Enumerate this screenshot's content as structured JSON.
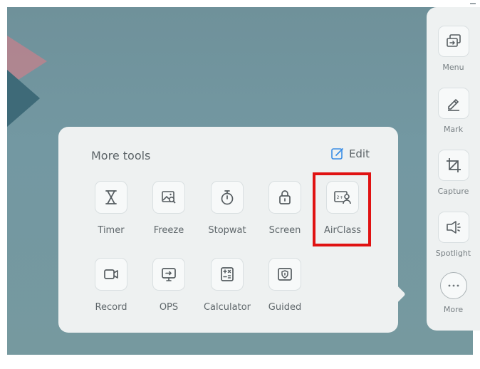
{
  "panel": {
    "title": "More tools",
    "edit_label": "Edit",
    "tools": [
      {
        "label": "Timer",
        "icon": "hourglass-icon"
      },
      {
        "label": "Freeze",
        "icon": "freeze-image-icon"
      },
      {
        "label": "Stopwat",
        "icon": "stopwatch-icon"
      },
      {
        "label": "Screen",
        "icon": "lock-icon"
      },
      {
        "label": "AirClass",
        "icon": "airclass-icon"
      },
      {
        "label": "Record",
        "icon": "video-camera-icon"
      },
      {
        "label": "OPS",
        "icon": "monitor-icon"
      },
      {
        "label": "Calculator",
        "icon": "calculator-icon"
      },
      {
        "label": "Guided",
        "icon": "shield-icon"
      }
    ]
  },
  "sidebar": {
    "items": [
      {
        "label": "Menu",
        "icon": "windows-icon"
      },
      {
        "label": "Mark",
        "icon": "pen-icon"
      },
      {
        "label": "Capture",
        "icon": "crop-icon"
      },
      {
        "label": "Spotlight",
        "icon": "spotlight-icon"
      },
      {
        "label": "More",
        "icon": "more-icon"
      }
    ]
  },
  "colors": {
    "highlight": "#e01212",
    "accent": "#3b8ee6",
    "background": "#7398a2"
  }
}
